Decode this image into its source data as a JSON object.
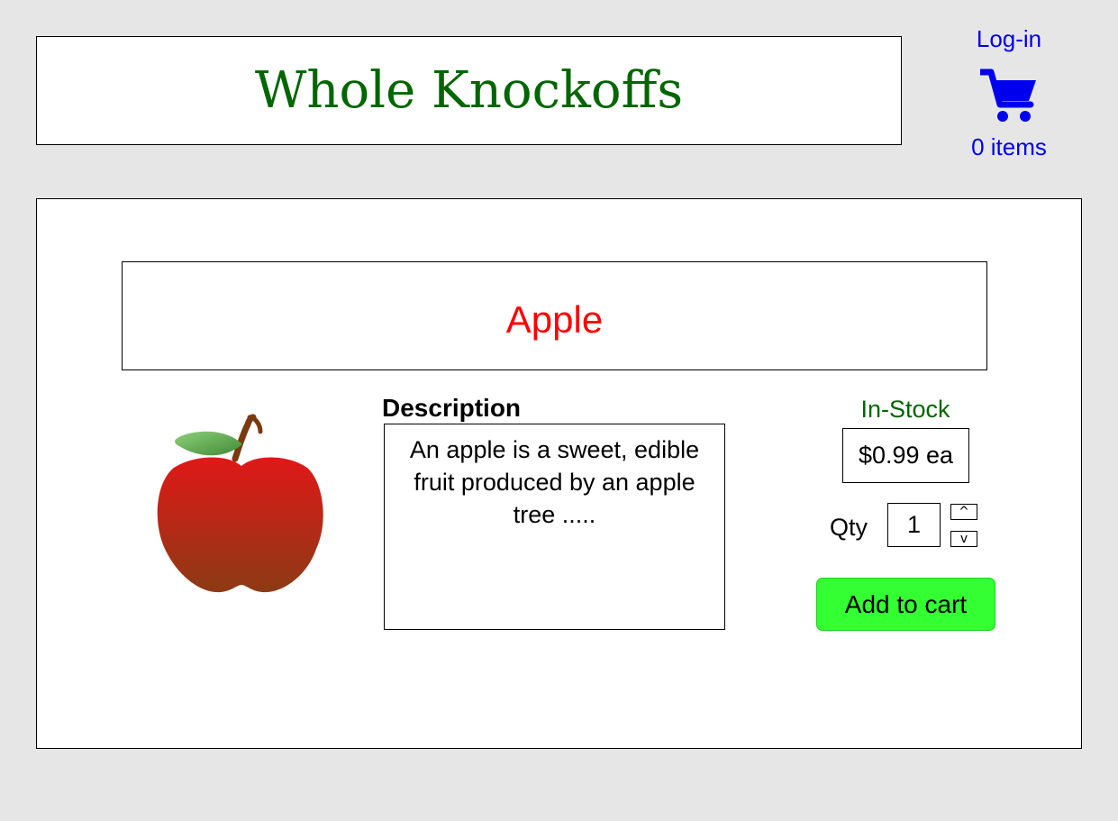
{
  "header": {
    "store_name": "Whole Knockoffs",
    "login_label": "Log-in",
    "cart_icon": "shopping-cart-icon",
    "cart_count": "0 items"
  },
  "product": {
    "name": "Apple",
    "image_icon": "apple-icon",
    "description_heading": "Description",
    "description": "An apple is a sweet, edible fruit produced by an apple tree .....",
    "stock_status": "In-Stock",
    "price": "$0.99 ea",
    "qty_label": "Qty",
    "qty_value": "1",
    "qty_up_label": "^",
    "qty_down_label": "v",
    "add_to_cart_label": "Add to cart"
  },
  "colors": {
    "page_background": "#e6e6e6",
    "store_name": "#006600",
    "links": "#0000ee",
    "product_name": "#ff0000",
    "in_stock": "#006600",
    "add_button": "#33ff33"
  }
}
